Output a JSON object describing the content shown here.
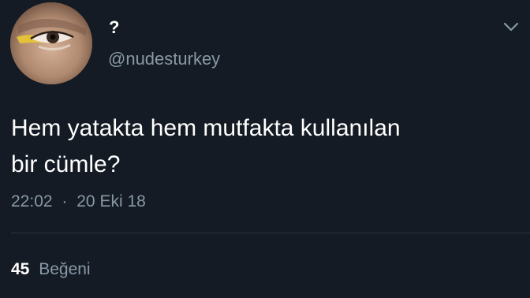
{
  "tweet": {
    "display_name": "?",
    "handle": "@nudesturkey",
    "text_line1": "Hem yatakta hem mutfakta kullanılan",
    "text_line2": "bir cümle?",
    "time": "22:02",
    "separator": "·",
    "date": "20 Eki 18",
    "like_count": "45",
    "like_label": "Beğeni"
  },
  "icons": {
    "avatar": "eye-photo-avatar",
    "menu": "chevron-down-icon"
  },
  "colors": {
    "background": "#141b24",
    "primary_text": "#ffffff",
    "secondary_text": "#8899a6",
    "divider": "#2a3440"
  }
}
